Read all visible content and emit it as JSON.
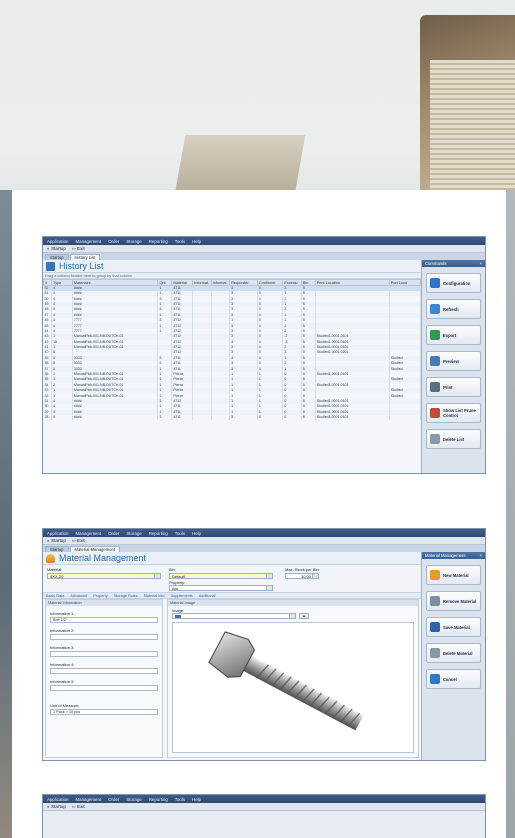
{
  "menu": [
    "Application",
    "Management",
    "Order",
    "Storage",
    "Reporting",
    "Tools",
    "Help"
  ],
  "toolbar": {
    "startup": "Startup",
    "exit": "Exit"
  },
  "history": {
    "tabs": [
      "Startup",
      "History List"
    ],
    "title": "History List",
    "group_hint": "Drag a column header here to group by that column",
    "columns": [
      "Type",
      "Materialnr.",
      "Qnt",
      "Material",
      "Informat.",
      "Informat.",
      "Requester",
      "Confirmer",
      "Excessi",
      "Bin",
      "Print Location",
      "Port Loca"
    ],
    "rows": [
      [
        "52",
        "4",
        "####",
        "1",
        "4711",
        "",
        "",
        "3",
        "0",
        "3",
        "5",
        "",
        ""
      ],
      [
        "51",
        "4",
        "####",
        "1",
        "4711",
        "",
        "",
        "3",
        "0",
        "1",
        "5",
        "",
        ""
      ],
      [
        "50",
        "4",
        "####",
        "3",
        "4711",
        "",
        "",
        "3",
        "0",
        "2",
        "5",
        "",
        ""
      ],
      [
        "49",
        "4",
        "####",
        "1",
        "4711",
        "",
        "",
        "3",
        "0",
        "1",
        "5",
        "",
        ""
      ],
      [
        "48",
        "4",
        "####",
        "3",
        "4711",
        "",
        "",
        "3",
        "0",
        "2",
        "5",
        "",
        ""
      ],
      [
        "47",
        "4",
        "####",
        "1",
        "4711",
        "",
        "",
        "3",
        "0",
        "1",
        "5",
        "",
        ""
      ],
      [
        "46",
        "4",
        "7777",
        "3",
        "4712",
        "",
        "",
        "1",
        "0",
        "1",
        "5",
        "",
        ""
      ],
      [
        "45",
        "4",
        "7777",
        "1",
        "4712",
        "",
        "",
        "3",
        "0",
        "2",
        "5",
        "",
        ""
      ],
      [
        "44",
        "4",
        "7777",
        "1",
        "4712",
        "",
        "",
        "3",
        "0",
        "2",
        "5",
        "",
        ""
      ],
      [
        "43",
        "1",
        "ManualPick-001-NB-DUTCH-01",
        "",
        "4712",
        "",
        "",
        "3",
        "0",
        "-2",
        "5",
        "Studied1-0001-0101",
        ""
      ],
      [
        "42",
        "18",
        "ManualPick-001-NB-DUTCH-01",
        "",
        "4712",
        "",
        "",
        "3",
        "0",
        "-3",
        "5",
        "Studied1-0001-0101",
        ""
      ],
      [
        "41",
        "1",
        "ManualPick-001-NB-DUTCH-01",
        "",
        "4712",
        "",
        "",
        "3",
        "0",
        "2",
        "5",
        "Studied1-0001-0101",
        ""
      ],
      [
        "40",
        "8",
        "",
        "",
        "4712",
        "",
        "",
        "3",
        "0",
        "3",
        "0",
        "Studied1-0001-0201",
        ""
      ],
      [
        "39",
        "5",
        "3333",
        "3",
        "4711",
        "",
        "",
        "3",
        "0",
        "1",
        "5",
        "",
        "Studied"
      ],
      [
        "38",
        "5",
        "3333",
        "3",
        "4711",
        "",
        "",
        "3",
        "0",
        "2",
        "5",
        "",
        "Studied"
      ],
      [
        "37",
        "5",
        "3333",
        "1",
        "4711",
        "",
        "",
        "3",
        "0",
        "1",
        "5",
        "",
        "Studied"
      ],
      [
        "36",
        "2",
        "ManualPick-001-NB-DUTCH-01",
        "1",
        "Pierce",
        "",
        "",
        "1",
        "1",
        "0",
        "5",
        "Studied1-0001-0101",
        ""
      ],
      [
        "35",
        "1",
        "ManualPick-001-NB-DUTCH-01",
        "1",
        "Pierce",
        "",
        "",
        "1",
        "1",
        "0",
        "5",
        "",
        "Studied"
      ],
      [
        "34",
        "2",
        "ManualPick-001-NB-DUTCH-01",
        "1",
        "Pierce",
        "",
        "",
        "1",
        "1",
        "0",
        "5",
        "Studied1-0001-0101",
        ""
      ],
      [
        "33",
        "1",
        "ManualPick-001-NB-DUTCH-01",
        "1",
        "Pierce",
        "",
        "",
        "1",
        "1",
        "0",
        "5",
        "",
        "Studied"
      ],
      [
        "32",
        "1",
        "ManualPick-001-NB-DUTCH-01",
        "1",
        "Pierce",
        "",
        "",
        "1",
        "1",
        "0",
        "5",
        "",
        "Studied"
      ],
      [
        "31",
        "4",
        "####",
        "3",
        "4712",
        "",
        "",
        "1",
        "1",
        "0",
        "5",
        "Studied1-0001-0101",
        ""
      ],
      [
        "30",
        "4",
        "####",
        "1",
        "4711",
        "",
        "",
        "1",
        "1",
        "0",
        "5",
        "Studied1-0001-0101",
        ""
      ],
      [
        "29",
        "4",
        "####",
        "1",
        "4711",
        "",
        "",
        "1",
        "1",
        "0",
        "5",
        "Studied1-0001-0101",
        ""
      ],
      [
        "28",
        "4",
        "####",
        "3",
        "4711",
        "",
        "",
        "3",
        "0",
        "0",
        "5",
        "Studied1-0001-0101",
        ""
      ]
    ],
    "commands_title": "Commands",
    "commands": [
      {
        "label": "Configuration",
        "icon": "list-config-icon",
        "color": "#2f73c7"
      },
      {
        "label": "Refresh",
        "icon": "refresh-icon",
        "color": "#3d86d6"
      },
      {
        "label": "Export",
        "icon": "export-icon",
        "color": "#2e9a4c"
      },
      {
        "label": "Preview",
        "icon": "preview-icon",
        "color": "#4b7ab0"
      },
      {
        "label": "Print",
        "icon": "printer-icon",
        "color": "#5b6d82"
      },
      {
        "label": "Show List Prune Control",
        "icon": "prune-icon",
        "color": "#c44b3b"
      },
      {
        "label": "Delete List",
        "icon": "delete-list-icon",
        "color": "#8a97a6"
      }
    ]
  },
  "material": {
    "tabs": [
      "Startup",
      "Material Management"
    ],
    "title": "Material Management",
    "material_label": "Material:",
    "material_value": "4XX-20",
    "bin_label": "Bin:",
    "bin_value": "Default",
    "property_label": "Property:",
    "property_value": "Bar",
    "max_label": "Max. Stock per Bin:",
    "max_value": "30.00",
    "subtabs": [
      "Basic Data",
      "Advanced",
      "Property",
      "Storage Rules",
      "Material Info",
      "Supplements",
      "Additional"
    ],
    "info_panel": "Material Information",
    "image_panel": "Material Image",
    "image_label": "Image:",
    "fields": [
      {
        "label": "Information 1:",
        "value": "Bolt 1/2\""
      },
      {
        "label": "Information 2:",
        "value": ""
      },
      {
        "label": "Information 3:",
        "value": ""
      },
      {
        "label": "Information 4:",
        "value": ""
      },
      {
        "label": "Information 5:",
        "value": ""
      }
    ],
    "uom_label": "Unit of Measure:",
    "uom_value": "1 Pack = 10 pcs",
    "commands_title": "Material Management",
    "commands": [
      {
        "label": "New Material",
        "icon": "new-material-icon",
        "color": "#e89a25"
      },
      {
        "label": "Remove Material",
        "icon": "remove-material-icon",
        "color": "#7f8fa2"
      },
      {
        "label": "Save Material",
        "icon": "save-icon",
        "color": "#2c64b2"
      },
      {
        "label": "Delete Material",
        "icon": "delete-icon",
        "color": "#8a97a6"
      },
      {
        "label": "Cancel",
        "icon": "cancel-icon",
        "color": "#2f7ac8"
      }
    ]
  }
}
